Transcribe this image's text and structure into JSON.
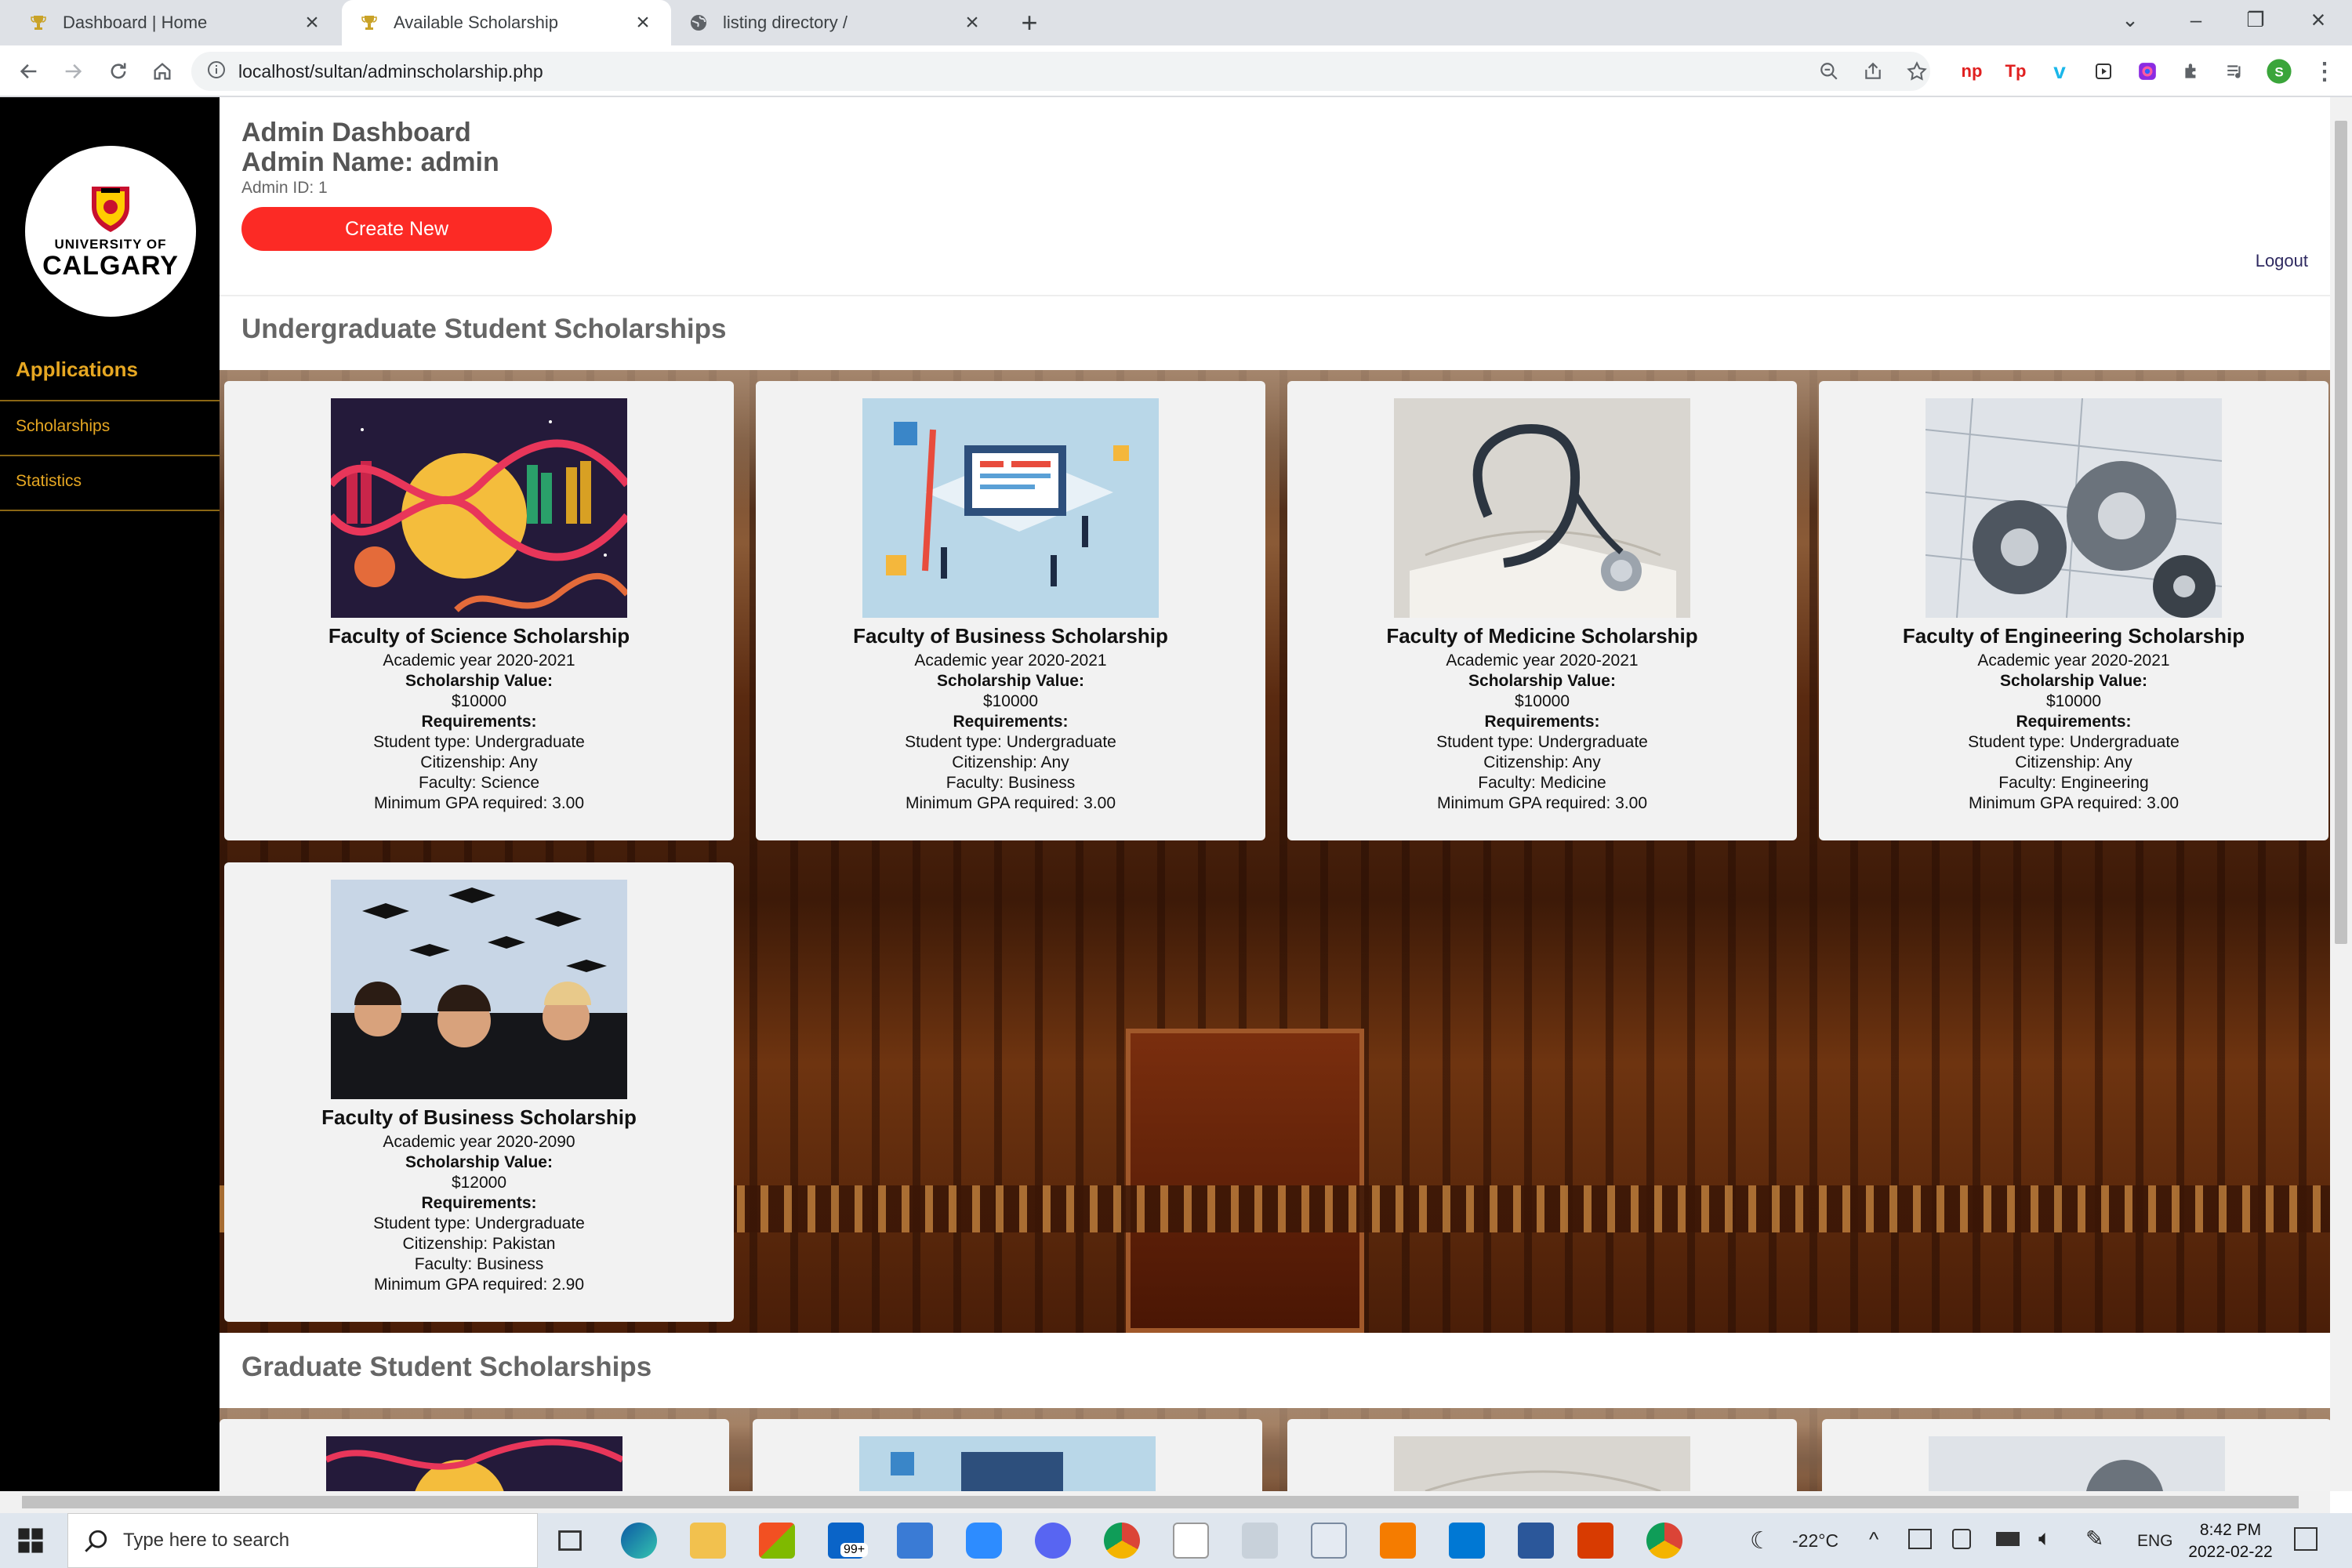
{
  "browser": {
    "tabs": [
      {
        "title": "Dashboard | Home",
        "icon": "trophy-icon"
      },
      {
        "title": "Available Scholarship",
        "icon": "trophy-icon"
      },
      {
        "title": "listing directory /",
        "icon": "globe-icon"
      }
    ],
    "url": "localhost/sultan/adminscholarship.php"
  },
  "sidebar": {
    "logo_line1": "UNIVERSITY OF",
    "logo_line2": "CALGARY",
    "heading": "Applications",
    "items": [
      {
        "label": "Scholarships"
      },
      {
        "label": "Statistics"
      }
    ]
  },
  "header": {
    "title": "Admin Dashboard",
    "admin_name": "Admin Name: admin",
    "admin_id": "Admin ID: 1",
    "create_button": "Create New",
    "logout": "Logout"
  },
  "sections": {
    "undergrad_title": "Undergraduate Student Scholarships",
    "grad_title": "Graduate Student Scholarships"
  },
  "labels": {
    "value_label": "Scholarship Value:",
    "req_label": "Requirements:"
  },
  "undergrad_cards": [
    {
      "title": "Faculty of Science Scholarship",
      "year": "Academic year 2020-2021",
      "value": "$10000",
      "student_type": "Student type: Undergraduate",
      "citizenship": "Citizenship: Any",
      "faculty": "Faculty: Science",
      "gpa": "Minimum GPA required: 3.00",
      "image": "science-dna-image"
    },
    {
      "title": "Faculty of Business Scholarship",
      "year": "Academic year 2020-2021",
      "value": "$10000",
      "student_type": "Student type: Undergraduate",
      "citizenship": "Citizenship: Any",
      "faculty": "Faculty: Business",
      "gpa": "Minimum GPA required: 3.00",
      "image": "business-isometric-image"
    },
    {
      "title": "Faculty of Medicine Scholarship",
      "year": "Academic year 2020-2021",
      "value": "$10000",
      "student_type": "Student type: Undergraduate",
      "citizenship": "Citizenship: Any",
      "faculty": "Faculty: Medicine",
      "gpa": "Minimum GPA required: 3.00",
      "image": "stethoscope-book-image"
    },
    {
      "title": "Faculty of Engineering Scholarship",
      "year": "Academic year 2020-2021",
      "value": "$10000",
      "student_type": "Student type: Undergraduate",
      "citizenship": "Citizenship: Any",
      "faculty": "Faculty: Engineering",
      "gpa": "Minimum GPA required: 3.00",
      "image": "gears-blueprint-image"
    },
    {
      "title": "Faculty of Business Scholarship",
      "year": "Academic year 2020-2090",
      "value": "$12000",
      "student_type": "Student type: Undergraduate",
      "citizenship": "Citizenship: Pakistan",
      "faculty": "Faculty: Business",
      "gpa": "Minimum GPA required: 2.90",
      "image": "graduation-caps-image"
    }
  ],
  "taskbar": {
    "search_placeholder": "Type here to search",
    "temperature": "-22°C",
    "language": "ENG",
    "time": "8:42 PM",
    "date": "2022-02-22",
    "mail_badge": "99+"
  }
}
